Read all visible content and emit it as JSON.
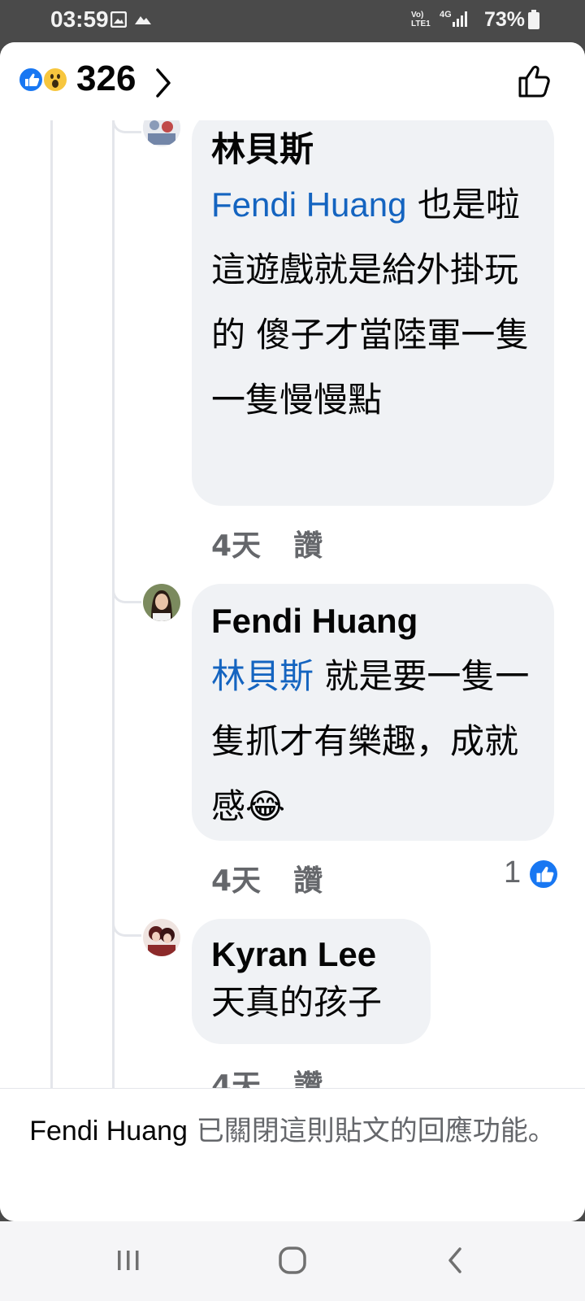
{
  "status_bar": {
    "time": "03:59",
    "network_label": "Vo) LTE1",
    "network_type": "4G",
    "battery": "73%"
  },
  "header": {
    "reaction_icons": [
      "like-icon",
      "wow-icon"
    ],
    "reaction_count": "326"
  },
  "comments": [
    {
      "author": "林貝斯",
      "mention": "Fendi Huang",
      "text": "也是啦這遊戲就是給外掛玩的 傻子才當陸軍一隻一隻慢慢點",
      "time": "4天",
      "like_label": "讚",
      "likes": ""
    },
    {
      "author": "Fendi Huang",
      "mention": "林貝斯",
      "text": "就是要一隻一隻抓才有樂趣，成就感",
      "emoji": "😂",
      "time": "4天",
      "like_label": "讚",
      "likes": "1"
    },
    {
      "author": "Kyran Lee",
      "mention": "",
      "text": "天真的孩子",
      "time": "4天",
      "like_label": "讚",
      "likes": ""
    }
  ],
  "footer": {
    "name": "Fendi Huang",
    "message": "已關閉這則貼文的回應功能。"
  },
  "colors": {
    "accent": "#1877f2",
    "mention": "#1464c0",
    "bubble": "#f0f2f5",
    "meta": "#65676b"
  }
}
